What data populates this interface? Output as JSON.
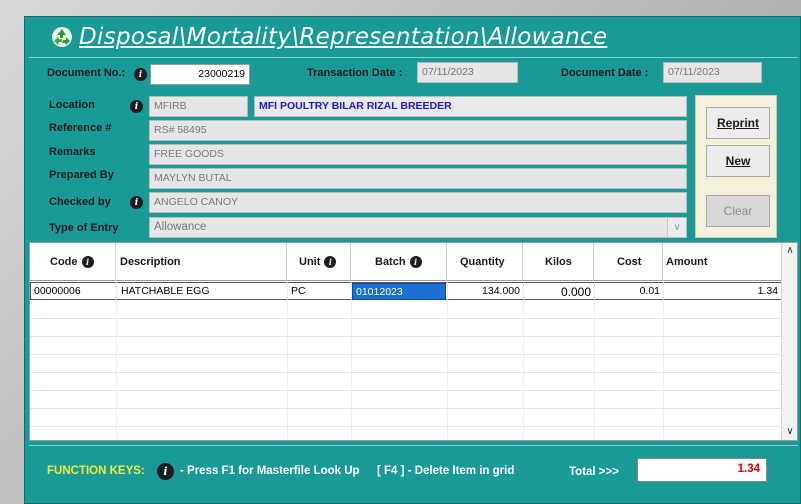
{
  "window": {
    "title": "Disposal\\Mortality\\Representation\\Allowance"
  },
  "header": {
    "doc_no_label": "Document No.:",
    "doc_no_value": "23000219",
    "trans_date_label": "Transaction Date :",
    "trans_date_value": "07/11/2023",
    "doc_date_label": "Document Date :",
    "doc_date_value": "07/11/2023"
  },
  "form": {
    "location_label": "Location",
    "location_code": "MFIRB",
    "location_name": "MFI POULTRY BILAR RIZAL BREEDER",
    "reference_label": "Reference #",
    "reference_value": "RS# 58495",
    "remarks_label": "Remarks",
    "remarks_value": "FREE GOODS",
    "prepared_label": "Prepared By",
    "prepared_value": "MAYLYN BUTAL",
    "checked_label": "Checked by",
    "checked_value": "ANGELO CANOY",
    "type_label": "Type of Entry",
    "type_value": "Allowance"
  },
  "buttons": {
    "reprint": "Reprint",
    "new": "New",
    "clear": "Clear"
  },
  "grid": {
    "columns": [
      "Code",
      "Description",
      "Unit",
      "Batch",
      "Quantity",
      "Kilos",
      "Cost",
      "Amount"
    ],
    "rows": [
      {
        "code": "00000006",
        "description": "HATCHABLE EGG",
        "unit": "PC",
        "batch": "01012023",
        "quantity": "134.000",
        "kilos": "0.000",
        "cost": "0.01",
        "amount": "1.34"
      }
    ]
  },
  "footer": {
    "function_keys_label": "FUNCTION KEYS:",
    "f1_text": "- Press F1 for Masterfile Look Up",
    "f4_text": "[ F4 ] - Delete Item in grid",
    "total_label": "Total >>>",
    "total_value": "1.34"
  },
  "colors": {
    "window_bg": "#1a9a96",
    "title_text": "#ffffff",
    "location_name_text": "#1a1adc",
    "function_keys_label": "#f1ec3a",
    "total_value_text": "#d40000",
    "selected_cell_bg": "#1a6fd0"
  }
}
